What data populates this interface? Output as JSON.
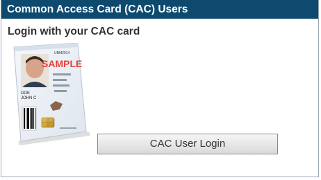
{
  "header": {
    "title": "Common Access Card (CAC) Users"
  },
  "content": {
    "subtitle": "Login with your CAC card"
  },
  "card": {
    "watermark": "SAMPLE",
    "name_line1": "DOE",
    "name_line2": "JOHN C",
    "top_right_text": "UBM2014"
  },
  "actions": {
    "login_label": "CAC User Login"
  },
  "colors": {
    "header_bg": "#0d4a6e",
    "header_text": "#ffffff",
    "button_border": "#8a8a8a",
    "watermark": "#e0302a"
  }
}
